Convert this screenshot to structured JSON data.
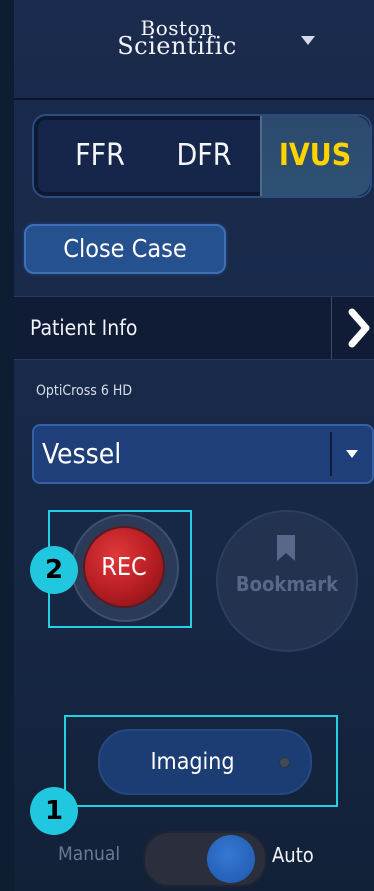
{
  "brand": {
    "line1": "Boston",
    "line2": "Scientific"
  },
  "modes": [
    {
      "label": "FFR"
    },
    {
      "label": "DFR"
    },
    {
      "label": "IVUS",
      "selected": true
    }
  ],
  "close_case_label": "Close Case",
  "patient_info_label": "Patient Info",
  "catheter_label": "OptiCross 6 HD",
  "vessel_select_value": "Vessel",
  "rec_label": "REC",
  "bookmark_label": "Bookmark",
  "imaging_label": "Imaging",
  "toggle": {
    "left_label": "Manual",
    "right_label": "Auto",
    "selected": "Auto"
  },
  "annotations": [
    {
      "number": "1"
    },
    {
      "number": "2"
    }
  ],
  "colors": {
    "accent_selected": "#ffd200",
    "rec_red": "#c0262b",
    "annotation_cyan": "#21c7df"
  }
}
